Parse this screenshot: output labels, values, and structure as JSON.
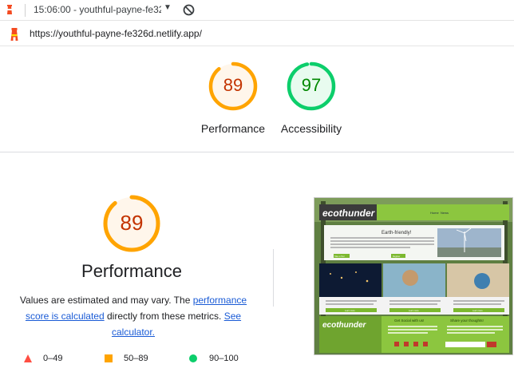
{
  "tab": {
    "title": "15:06:00 - youthful-payne-fe32",
    "caret": "▼"
  },
  "address": {
    "url": "https://youthful-payne-fe326d.netlify.app/"
  },
  "summary": [
    {
      "label": "Performance",
      "score": 89,
      "fraction": 0.89,
      "color": "#ffa400",
      "text_color": "#c33300",
      "fill": "#fff6eb"
    },
    {
      "label": "Accessibility",
      "score": 97,
      "fraction": 0.97,
      "color": "#0cce6b",
      "text_color": "#008800",
      "fill": "#e8fbef"
    }
  ],
  "detail": {
    "score": 89,
    "fraction": 0.89,
    "title": "Performance",
    "desc_prefix": "Values are estimated and may vary. The ",
    "link1": "performance score is calculated",
    "desc_mid": " directly from these metrics. ",
    "link2": "See calculator."
  },
  "legend": [
    {
      "range": "0–49",
      "shape": "triangle",
      "color": "#ff4e42"
    },
    {
      "range": "50–89",
      "shape": "square",
      "color": "#ffa400"
    },
    {
      "range": "90–100",
      "shape": "circle",
      "color": "#0cce6b"
    }
  ],
  "thumbnail": {
    "logo": "ecothunder",
    "nav": [
      "Home",
      "News"
    ],
    "hero_title": "Earth-friendly!",
    "hero_body": "This website template has been designed by Free Website Templates for you, for free. You can replace all this text with your own text. You can remove any link to our website from this website template, you're free to use this website template without linking back to us.",
    "buttons": [
      "Take a Tour",
      "Register"
    ],
    "cards": [
      "Learn more",
      "Learn more",
      "Learn more"
    ],
    "footer_social": "Get Social with us!",
    "footer_share": "Share your thoughts!"
  }
}
